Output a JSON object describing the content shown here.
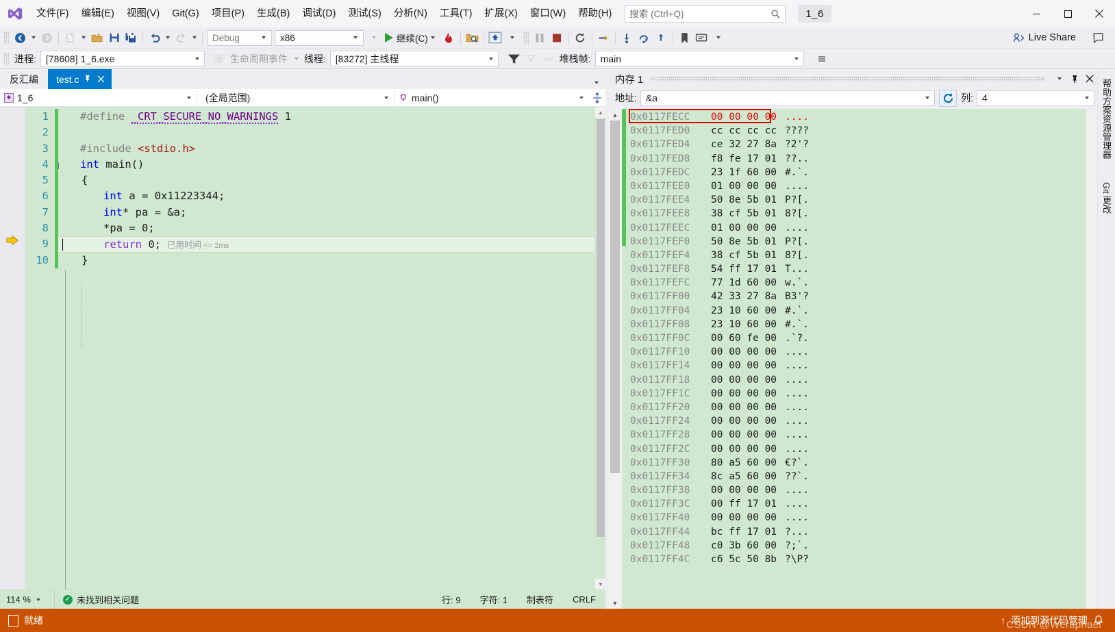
{
  "titlebar": {
    "menu": [
      {
        "label": "文件(F)",
        "name": "menu-file"
      },
      {
        "label": "编辑(E)",
        "name": "menu-edit"
      },
      {
        "label": "视图(V)",
        "name": "menu-view"
      },
      {
        "label": "Git(G)",
        "name": "menu-git"
      },
      {
        "label": "项目(P)",
        "name": "menu-project"
      },
      {
        "label": "生成(B)",
        "name": "menu-build"
      },
      {
        "label": "调试(D)",
        "name": "menu-debug"
      },
      {
        "label": "测试(S)",
        "name": "menu-test"
      },
      {
        "label": "分析(N)",
        "name": "menu-analyze"
      },
      {
        "label": "工具(T)",
        "name": "menu-tools"
      },
      {
        "label": "扩展(X)",
        "name": "menu-extensions"
      },
      {
        "label": "窗口(W)",
        "name": "menu-window"
      },
      {
        "label": "帮助(H)",
        "name": "menu-help"
      }
    ],
    "search_placeholder": "搜索 (Ctrl+Q)",
    "search_value": "",
    "solution_badge": "1_6",
    "minimize": "—",
    "maximize": "▢",
    "close": "✕"
  },
  "toolbar": {
    "back_icon": "back-arrow-icon",
    "forward_icon": "forward-arrow-icon",
    "new_icon": "new-file-icon",
    "open_icon": "open-folder-icon",
    "save_icon": "save-icon",
    "save_all_icon": "save-all-icon",
    "undo_icon": "undo-icon",
    "redo_icon": "redo-icon",
    "config": "Debug",
    "platform": "x86",
    "continue_label": "继续(C)",
    "hot_reload_icon": "hot-reload-icon",
    "search_target_icon": "search-target-icon",
    "home_icon": "step-home-icon",
    "pause_icon": "pause-icon",
    "stop_icon": "stop-icon",
    "live_share": "Live Share"
  },
  "debugbar": {
    "process_label": "进程:",
    "process_value": "[78608] 1_6.exe",
    "lifecycle_label": "生命周期事件",
    "thread_label": "线程:",
    "thread_value": "[83272] 主线程",
    "stackframe_label": "堆栈帧:",
    "stackframe_value": "main"
  },
  "editor": {
    "tab_disasm": "反汇编",
    "tab_active": "test.c",
    "tab_pin": "⌐",
    "tab_close": "✕",
    "nav_project": "1_6",
    "nav_scope": "(全局范围)",
    "nav_symbol": "main()",
    "lines": [
      {
        "n": "1",
        "html": "segments"
      },
      {
        "n": "2",
        "html": "blank"
      },
      {
        "n": "3",
        "html": "include"
      },
      {
        "n": "4",
        "html": "main"
      },
      {
        "n": "5",
        "html": "brace-open"
      },
      {
        "n": "6",
        "html": "decl-a"
      },
      {
        "n": "7",
        "html": "decl-pa"
      },
      {
        "n": "8",
        "html": "assign"
      },
      {
        "n": "9",
        "html": "return"
      },
      {
        "n": "10",
        "html": "brace-close"
      }
    ],
    "code": {
      "l1_define": "#define",
      "l1_macro": "_CRT_SECURE_NO_WARNINGS",
      "l1_val": "1",
      "l3_include": "#include",
      "l3_hdr": "<stdio.h>",
      "l4_int": "int",
      "l4_main": "main()",
      "l5": "{",
      "l6_int": "int",
      "l6_rest": " a = 0x11223344;",
      "l7_int": "int",
      "l7_rest": "* pa = &a;",
      "l8": "*pa = 0;",
      "l9_return": "return",
      "l9_rest": " 0;",
      "l9_elapsed": "已用时间",
      "l9_elapsed_val": "<= 2ms",
      "l10": "}"
    },
    "status": {
      "zoom": "114 %",
      "problems": "未找到相关问题",
      "line": "行: 9",
      "char": "字符: 1",
      "tabs": "制表符",
      "eol": "CRLF"
    }
  },
  "memory": {
    "title": "内存 1",
    "dropdown_icon": "chevron-down-icon",
    "pin_icon": "pin-icon",
    "close_icon": "close-icon",
    "address_label": "地址:",
    "address_value": "&a",
    "refresh_icon": "refresh-icon",
    "columns_label": "列:",
    "columns_value": "4",
    "rows": [
      {
        "addr": "0x0117FECC",
        "hex": "00 00 00 00",
        "ascii": "....",
        "highlight": true
      },
      {
        "addr": "0x0117FED0",
        "hex": "cc cc cc cc",
        "ascii": "????",
        "highlight": false
      },
      {
        "addr": "0x0117FED4",
        "hex": "ce 32 27 8a",
        "ascii": "?2'?",
        "highlight": false
      },
      {
        "addr": "0x0117FED8",
        "hex": "f8 fe 17 01",
        "ascii": "??..",
        "highlight": false
      },
      {
        "addr": "0x0117FEDC",
        "hex": "23 1f 60 00",
        "ascii": "#.`.",
        "highlight": false
      },
      {
        "addr": "0x0117FEE0",
        "hex": "01 00 00 00",
        "ascii": "....",
        "highlight": false
      },
      {
        "addr": "0x0117FEE4",
        "hex": "50 8e 5b 01",
        "ascii": "P?[.",
        "highlight": false
      },
      {
        "addr": "0x0117FEE8",
        "hex": "38 cf 5b 01",
        "ascii": "8?[.",
        "highlight": false
      },
      {
        "addr": "0x0117FEEC",
        "hex": "01 00 00 00",
        "ascii": "....",
        "highlight": false
      },
      {
        "addr": "0x0117FEF0",
        "hex": "50 8e 5b 01",
        "ascii": "P?[.",
        "highlight": false
      },
      {
        "addr": "0x0117FEF4",
        "hex": "38 cf 5b 01",
        "ascii": "8?[.",
        "highlight": false
      },
      {
        "addr": "0x0117FEF8",
        "hex": "54 ff 17 01",
        "ascii": "T...",
        "highlight": false
      },
      {
        "addr": "0x0117FEFC",
        "hex": "77 1d 60 00",
        "ascii": "w.`.",
        "highlight": false
      },
      {
        "addr": "0x0117FF00",
        "hex": "42 33 27 8a",
        "ascii": "B3'?",
        "highlight": false
      },
      {
        "addr": "0x0117FF04",
        "hex": "23 10 60 00",
        "ascii": "#.`.",
        "highlight": false
      },
      {
        "addr": "0x0117FF08",
        "hex": "23 10 60 00",
        "ascii": "#.`.",
        "highlight": false
      },
      {
        "addr": "0x0117FF0C",
        "hex": "00 60 fe 00",
        "ascii": ".`?.",
        "highlight": false
      },
      {
        "addr": "0x0117FF10",
        "hex": "00 00 00 00",
        "ascii": "....",
        "highlight": false
      },
      {
        "addr": "0x0117FF14",
        "hex": "00 00 00 00",
        "ascii": "....",
        "highlight": false
      },
      {
        "addr": "0x0117FF18",
        "hex": "00 00 00 00",
        "ascii": "....",
        "highlight": false
      },
      {
        "addr": "0x0117FF1C",
        "hex": "00 00 00 00",
        "ascii": "....",
        "highlight": false
      },
      {
        "addr": "0x0117FF20",
        "hex": "00 00 00 00",
        "ascii": "....",
        "highlight": false
      },
      {
        "addr": "0x0117FF24",
        "hex": "00 00 00 00",
        "ascii": "....",
        "highlight": false
      },
      {
        "addr": "0x0117FF28",
        "hex": "00 00 00 00",
        "ascii": "....",
        "highlight": false
      },
      {
        "addr": "0x0117FF2C",
        "hex": "00 00 00 00",
        "ascii": "....",
        "highlight": false
      },
      {
        "addr": "0x0117FF30",
        "hex": "80 a5 60 00",
        "ascii": "€?`.",
        "highlight": false
      },
      {
        "addr": "0x0117FF34",
        "hex": "8c a5 60 00",
        "ascii": "??`.",
        "highlight": false
      },
      {
        "addr": "0x0117FF38",
        "hex": "00 00 00 00",
        "ascii": "....",
        "highlight": false
      },
      {
        "addr": "0x0117FF3C",
        "hex": "00 ff 17 01",
        "ascii": "....",
        "highlight": false
      },
      {
        "addr": "0x0117FF40",
        "hex": "00 00 00 00",
        "ascii": "....",
        "highlight": false
      },
      {
        "addr": "0x0117FF44",
        "hex": "bc ff 17 01",
        "ascii": "?...",
        "highlight": false
      },
      {
        "addr": "0x0117FF48",
        "hex": "c0 3b 60 00",
        "ascii": "?;`.",
        "highlight": false
      },
      {
        "addr": "0x0117FF4C",
        "hex": "c6 5c 50 8b",
        "ascii": "?\\P?",
        "highlight": false
      }
    ]
  },
  "dockstrip": {
    "tabs": [
      "帮助方案资源管理器",
      "Git 更改"
    ]
  },
  "statusbar": {
    "ready": "就绪",
    "source_control": "添加到源代码管理",
    "watermark": "CSDN @Weraphael",
    "bell_icon": "bell-icon",
    "up_arrow": "↑"
  }
}
